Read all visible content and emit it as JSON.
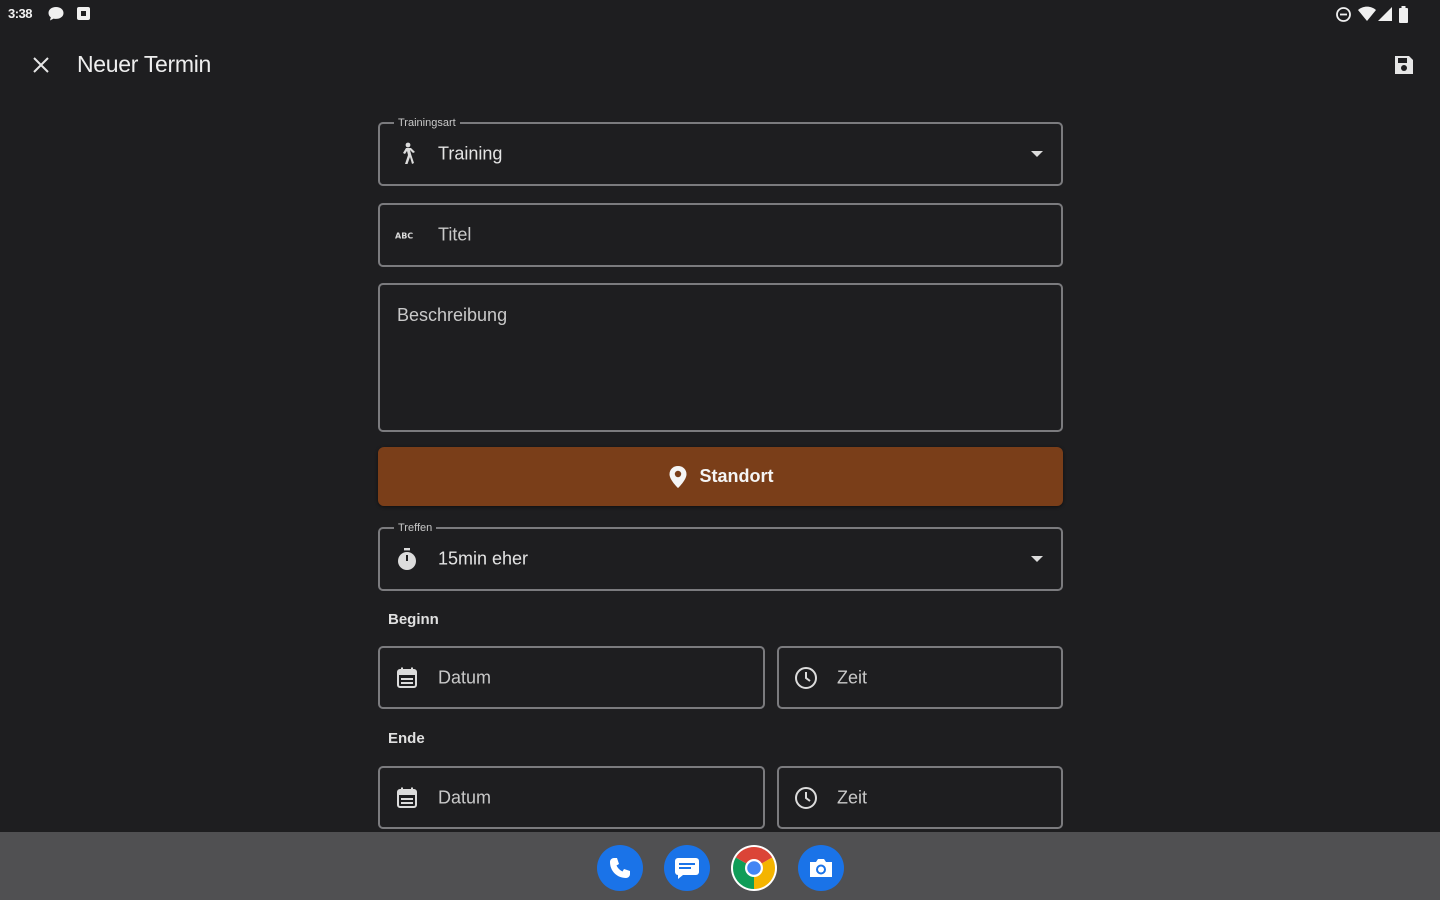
{
  "status_bar": {
    "time": "3:38",
    "left_icons": [
      "chat-notification-icon",
      "app-notification-icon"
    ],
    "right_icons": [
      "dnd-icon",
      "wifi-icon",
      "signal-icon",
      "battery-icon"
    ]
  },
  "app_bar": {
    "title": "Neuer Termin",
    "close_icon": "close-icon",
    "save_icon": "save-icon"
  },
  "form": {
    "training_type": {
      "label": "Trainingsart",
      "value": "Training",
      "icon": "walk-icon"
    },
    "title_field": {
      "placeholder": "Titel",
      "icon": "abc-icon"
    },
    "description_field": {
      "placeholder": "Beschreibung"
    },
    "location_button": {
      "label": "Standort",
      "icon": "location-pin-icon",
      "color": "#7a3e19"
    },
    "meeting": {
      "label": "Treffen",
      "value": "15min eher",
      "icon": "timer-icon"
    },
    "begin": {
      "section_label": "Beginn",
      "date_placeholder": "Datum",
      "time_placeholder": "Zeit"
    },
    "end": {
      "section_label": "Ende",
      "date_placeholder": "Datum",
      "time_placeholder": "Zeit"
    }
  },
  "dock": {
    "apps": [
      "phone-app-icon",
      "messages-app-icon",
      "chrome-app-icon",
      "camera-app-icon"
    ]
  },
  "colors": {
    "background": "#1e1e20",
    "accent": "#7a3e19",
    "field_border": "#7b7b7e",
    "nav_bar": "#505052"
  }
}
